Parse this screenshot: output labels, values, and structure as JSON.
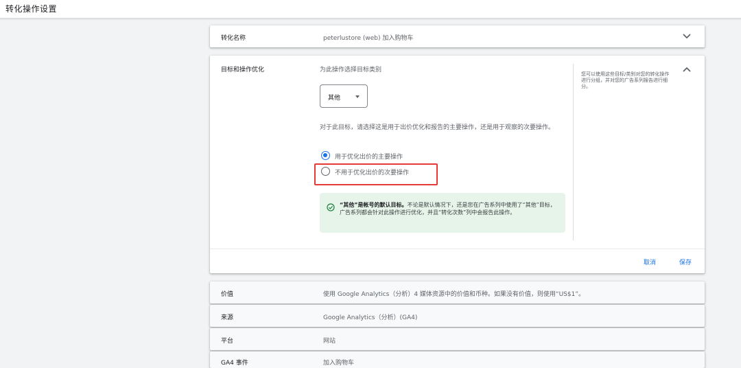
{
  "page": {
    "title": "转化操作设置"
  },
  "conversion_name": {
    "label": "转化名称",
    "value": "peterlustore (web) 加入购物车"
  },
  "goal_section": {
    "label": "目标和操作优化",
    "prompt": "为此操作选择目标类别",
    "select": {
      "value": "其他"
    },
    "description": "对于此目标，请选择这是用于出价优化和报告的主要操作，还是用于观察的次要操作。",
    "options": [
      {
        "label": "用于优化出价的主要操作",
        "checked": true
      },
      {
        "label": "不用于优化出价的次要操作",
        "checked": false
      }
    ],
    "notice": {
      "bold": "“其他”是帐号的默认目标。",
      "text": "不论是默认情况下，还是您在广告系列中使用了“其他”目标，广告系列都会针对此操作进行优化，并且“转化次数”列中会报告此操作。"
    },
    "help_text": "您可以使用这些目标/类别对您的转化操作进行分组，并对您的广告系列报告进行细分。",
    "cancel_label": "取消",
    "save_label": "保存"
  },
  "rows": [
    {
      "label": "价值",
      "value": "使用 Google Analytics（分析）4 媒体资源中的价值和币种。如果没有价值，则使用“US$1”。"
    },
    {
      "label": "来源",
      "value": "Google Analytics（分析）(GA4)"
    },
    {
      "label": "平台",
      "value": "网站"
    },
    {
      "label": "GA4 事件",
      "value": "加入购物车"
    }
  ],
  "colors": {
    "accent": "#1a73e8",
    "notice_bg": "#e6f4ea",
    "check": "#188038",
    "highlight": "#e53935"
  },
  "icons": {
    "collapsed": "chevron-down-icon",
    "expanded": "chevron-up-icon",
    "notice": "check-circle-icon",
    "select": "dropdown-caret-icon"
  }
}
